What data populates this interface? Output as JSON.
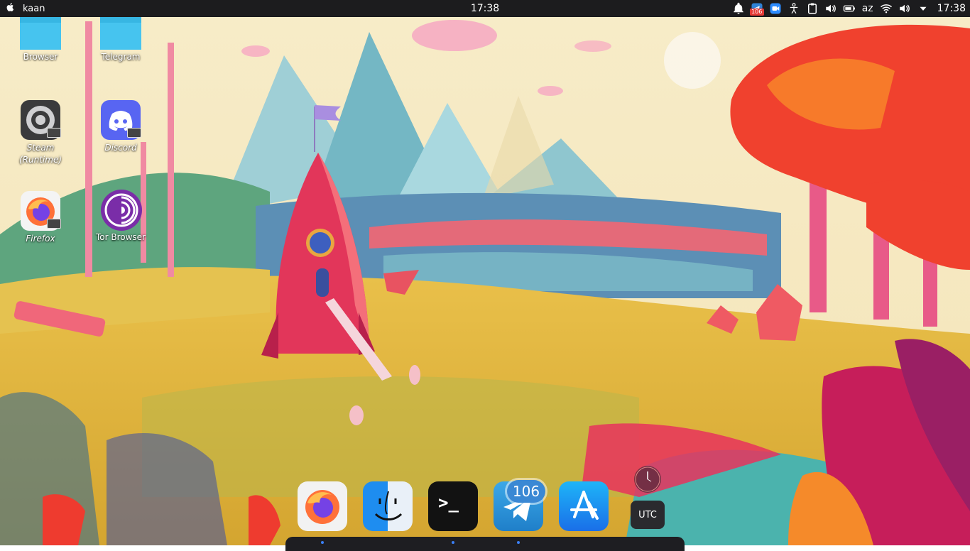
{
  "topbar": {
    "user": "kaan",
    "clock_center": "17:38",
    "notification_count": "106",
    "keyboard_layout": "az",
    "clock_right": "17:38",
    "tray_icons": [
      "bell-icon",
      "telegram-tray-icon",
      "zoom-icon",
      "accessibility-icon",
      "clipboard-icon",
      "volume-icon",
      "battery-icon",
      "keyboard-layout-indicator",
      "wifi-icon",
      "volume-icon",
      "dropdown-arrow-icon"
    ]
  },
  "desktop": {
    "icons": [
      {
        "label": "Browser",
        "icon": "folder-icon"
      },
      {
        "label": "Telegram",
        "icon": "folder-icon"
      },
      {
        "label": "Steam (Runtime)",
        "icon": "steam-icon"
      },
      {
        "label": "Discord",
        "icon": "discord-icon"
      },
      {
        "label": "Firefox",
        "icon": "firefox-icon"
      },
      {
        "label": "Tor Browser",
        "icon": "tor-icon"
      }
    ]
  },
  "dock": {
    "apps": [
      {
        "name": "Firefox",
        "icon": "firefox-icon"
      },
      {
        "name": "Finder",
        "icon": "finder-icon"
      },
      {
        "name": "Terminal",
        "icon": "terminal-icon",
        "glyph": ">_"
      },
      {
        "name": "Telegram",
        "icon": "telegram-icon",
        "badge": "106"
      },
      {
        "name": "App Store",
        "icon": "app-store-icon"
      }
    ],
    "clock_widget_label": "UTC"
  },
  "colors": {
    "accent": "#3a7ff6",
    "topbar": "#1c1c1e",
    "folder": "#37b6e3"
  }
}
